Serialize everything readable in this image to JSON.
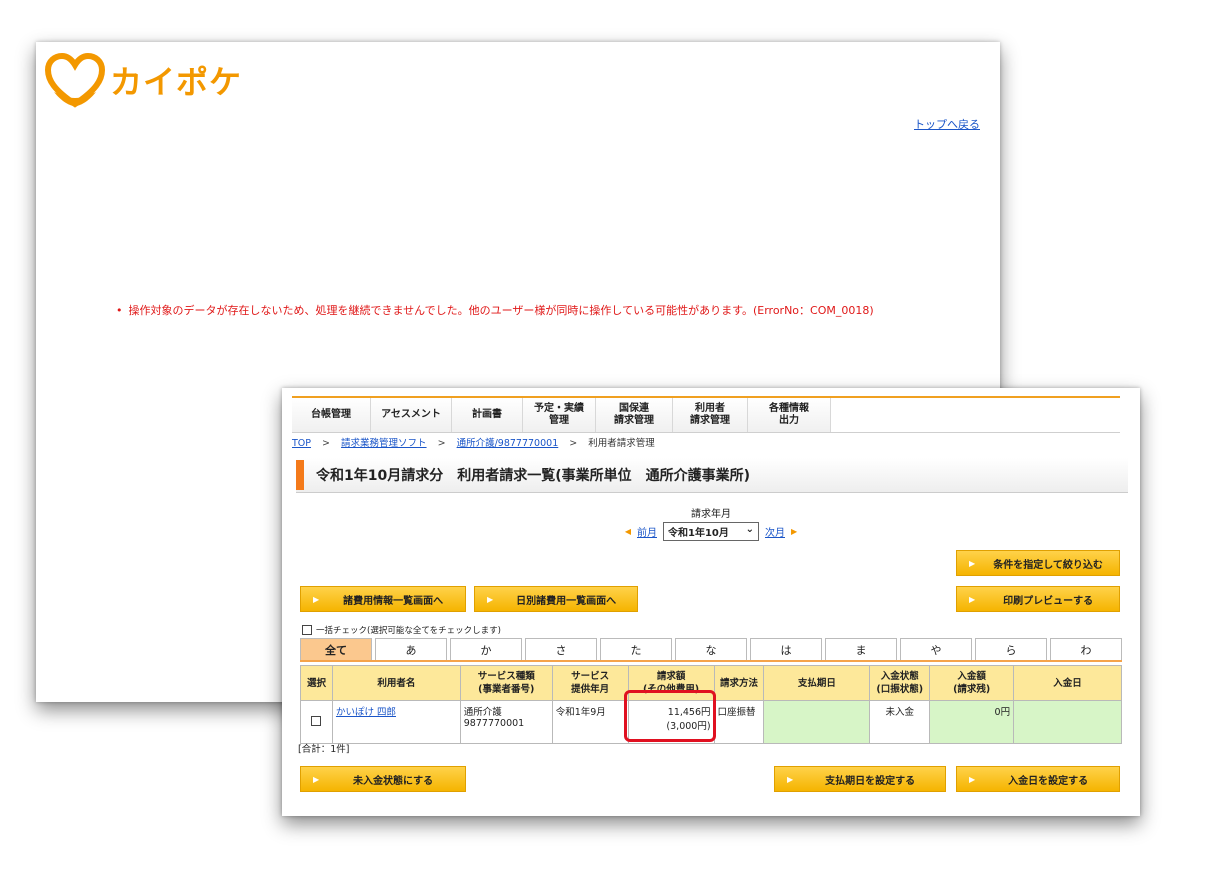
{
  "back_window": {
    "logo_text": "カイポケ",
    "brand_color": "#f39800",
    "top_link": "トップへ戻る",
    "error_message": "操作対象のデータが存在しないため、処理を継続できませんでした。他のユーザー様が同時に操作している可能性があります。(ErrorNo：COM_0018)",
    "error_color": "#e01818"
  },
  "front_window": {
    "nav_tabs": [
      {
        "label": "台帳管理"
      },
      {
        "label": "アセスメント"
      },
      {
        "label": "計画書"
      },
      {
        "label": "予定・実績\n管理"
      },
      {
        "label": "国保連\n請求管理"
      },
      {
        "label": "利用者\n請求管理"
      },
      {
        "label": "各種情報\n出力"
      }
    ],
    "breadcrumb": {
      "top": "TOP",
      "item1": "請求業務管理ソフト",
      "item2": "通所介護/9877770001",
      "current": "利用者請求管理",
      "separator": ">"
    },
    "page_title": "令和1年10月請求分　利用者請求一覧(事業所単位　通所介護事業所)",
    "month_label": "請求年月",
    "prev_month": "前月",
    "next_month": "次月",
    "month_value": "令和1年10月",
    "buttons": {
      "filter": "条件を指定して絞り込む",
      "cost_info": "諸費用情報一覧画面へ",
      "daily_cost": "日別諸費用一覧画面へ",
      "print_preview": "印刷プレビューする",
      "unpaid": "未入金状態にする",
      "set_due_date": "支払期日を設定する",
      "set_payment_date": "入金日を設定する"
    },
    "bulk_check_label": "一括チェック(選択可能な全てをチェックします)",
    "kana_tabs": [
      "全て",
      "あ",
      "か",
      "さ",
      "た",
      "な",
      "は",
      "ま",
      "や",
      "ら",
      "わ"
    ],
    "table": {
      "headers": {
        "select": "選択",
        "user_name": "利用者名",
        "service_type": "サービス種類\n(事業者番号)",
        "service_month": "サービス\n提供年月",
        "amount": "請求額\n(その他費用)",
        "method": "請求方法",
        "due_date": "支払期日",
        "payment_status": "入金状態\n(口振状態)",
        "payment_amount": "入金額\n(請求残)",
        "payment_date": "入金日"
      },
      "rows": [
        {
          "user_name": "かいぽけ 四郎",
          "service_type": "通所介護",
          "business_no": "9877770001",
          "service_month": "令和1年9月",
          "amount": "11,456円",
          "other_cost": "(3,000円)",
          "method": "口座振替",
          "due_date": "",
          "payment_status": "未入金",
          "payment_amount": "0円",
          "payment_date": ""
        }
      ]
    },
    "total": "[合計：1件]"
  }
}
